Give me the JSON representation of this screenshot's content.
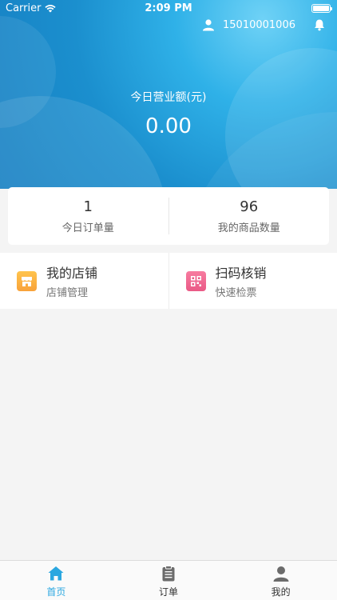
{
  "status_bar": {
    "carrier": "Carrier",
    "time": "2:09 PM"
  },
  "header": {
    "username": "15010001006"
  },
  "revenue": {
    "label": "今日营业额(元)",
    "value": "0.00"
  },
  "stats": [
    {
      "value": "1",
      "label": "今日订单量"
    },
    {
      "value": "96",
      "label": "我的商品数量"
    }
  ],
  "menu": [
    {
      "title": "我的店铺",
      "subtitle": "店铺管理",
      "icon": "store-icon"
    },
    {
      "title": "扫码核销",
      "subtitle": "快速检票",
      "icon": "scan-icon"
    }
  ],
  "tabs": [
    {
      "label": "首页",
      "icon": "home-icon",
      "active": true
    },
    {
      "label": "订单",
      "icon": "clipboard-icon",
      "active": false
    },
    {
      "label": "我的",
      "icon": "person-icon",
      "active": false
    }
  ],
  "colors": {
    "accent": "#2aa7e0",
    "store": "#f8a23a",
    "scan": "#ea5a86"
  }
}
